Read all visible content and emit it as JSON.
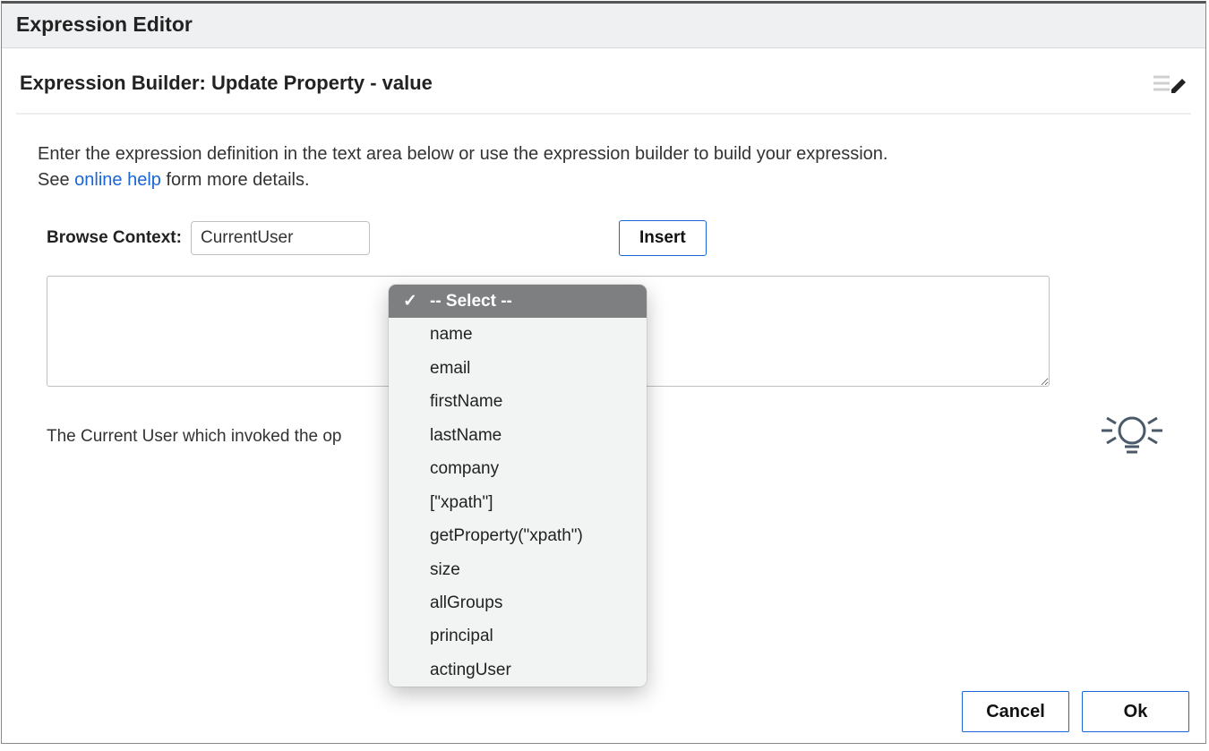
{
  "dialog": {
    "title": "Expression Editor"
  },
  "builder": {
    "title": "Expression Builder: Update Property - value"
  },
  "instructions": {
    "line1_prefix": "Enter the expression definition in the text area below or use the expression builder to build your expression.",
    "line2_prefix": "See ",
    "help_link": "online help",
    "line2_suffix": " form more details."
  },
  "browse": {
    "label": "Browse Context:",
    "context_value": "CurrentUser",
    "insert_label": "Insert"
  },
  "textarea": {
    "value": ""
  },
  "hint": {
    "text": "The Current User which invoked the op"
  },
  "dropdown": {
    "selected_index": 0,
    "items": [
      "-- Select --",
      "name",
      "email",
      "firstName",
      "lastName",
      "company",
      "[\"xpath\"]",
      "getProperty(\"xpath\")",
      "size",
      "allGroups",
      "principal",
      "actingUser"
    ]
  },
  "footer": {
    "cancel_label": "Cancel",
    "ok_label": "Ok"
  }
}
